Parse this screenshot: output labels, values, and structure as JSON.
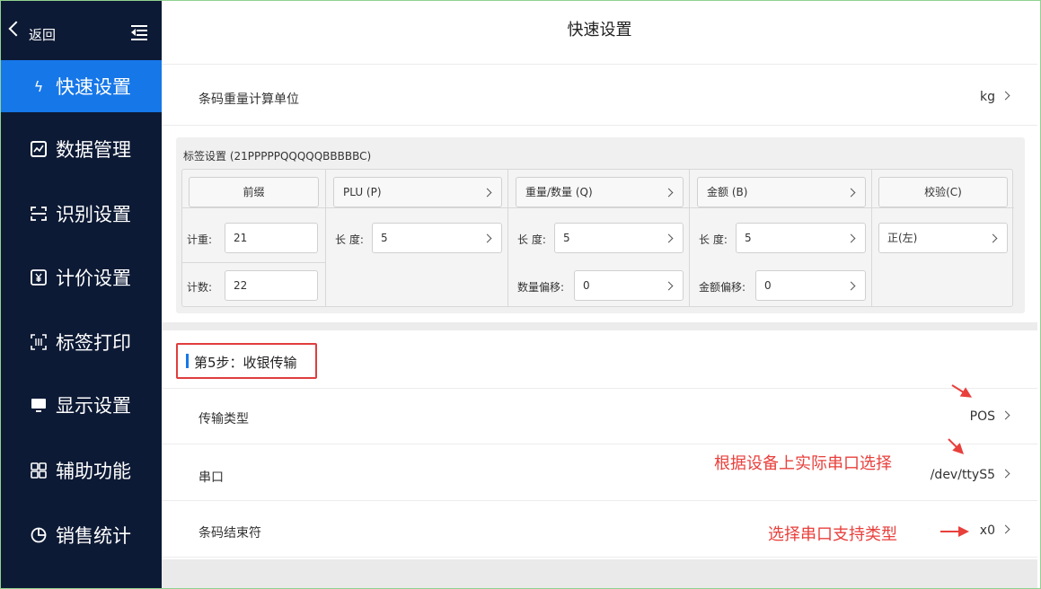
{
  "sidebar": {
    "back_label": "返回",
    "items": [
      {
        "label": "快速设置",
        "icon": "lightning-icon",
        "glyph": "ϟ",
        "active": true
      },
      {
        "label": "数据管理",
        "icon": "chart-icon",
        "glyph": "",
        "active": false
      },
      {
        "label": "识别设置",
        "icon": "scan-icon",
        "glyph": "",
        "active": false
      },
      {
        "label": "计价设置",
        "icon": "yen-icon",
        "glyph": "¥",
        "active": false
      },
      {
        "label": "标签打印",
        "icon": "barcode-icon",
        "glyph": "",
        "active": false
      },
      {
        "label": "显示设置",
        "icon": "monitor-icon",
        "glyph": "",
        "active": false
      },
      {
        "label": "辅助功能",
        "icon": "grid-icon",
        "glyph": "",
        "active": false
      },
      {
        "label": "销售统计",
        "icon": "pie-icon",
        "glyph": "",
        "active": false
      }
    ]
  },
  "header": {
    "title": "快速设置"
  },
  "barcode_unit": {
    "label": "条码重量计算单位",
    "value": "kg"
  },
  "label_settings": {
    "title": "标签设置 (21PPPPPQQQQQBBBBBC)",
    "columns": {
      "prefix": "前缀",
      "plu": "PLU (P)",
      "qty": "重量/数量 (Q)",
      "amount": "金额 (B)",
      "check": "校验(C)"
    },
    "prefix_weight_label": "计重:",
    "prefix_weight_value": "21",
    "prefix_count_label": "计数:",
    "prefix_count_value": "22",
    "length_label": "长 度:",
    "plu_length": "5",
    "qty_length": "5",
    "amount_length": "5",
    "qty_offset_label": "数量偏移:",
    "qty_offset_value": "0",
    "amount_offset_label": "金额偏移:",
    "amount_offset_value": "0",
    "check_value": "正(左)"
  },
  "step5": {
    "label": "第5步：收银传输"
  },
  "transfer_type": {
    "label": "传输类型",
    "value": "POS"
  },
  "serial_port": {
    "label": "串口",
    "value": "/dev/ttyS5"
  },
  "terminator": {
    "label": "条码结束符",
    "value": "x0"
  },
  "annotations": {
    "serial_hint": "根据设备上实际串口选择",
    "type_hint": "选择串口支持类型",
    "color": "#e8403c"
  },
  "colors": {
    "sidebar_bg": "#0d1a35",
    "accent": "#1677e8"
  }
}
